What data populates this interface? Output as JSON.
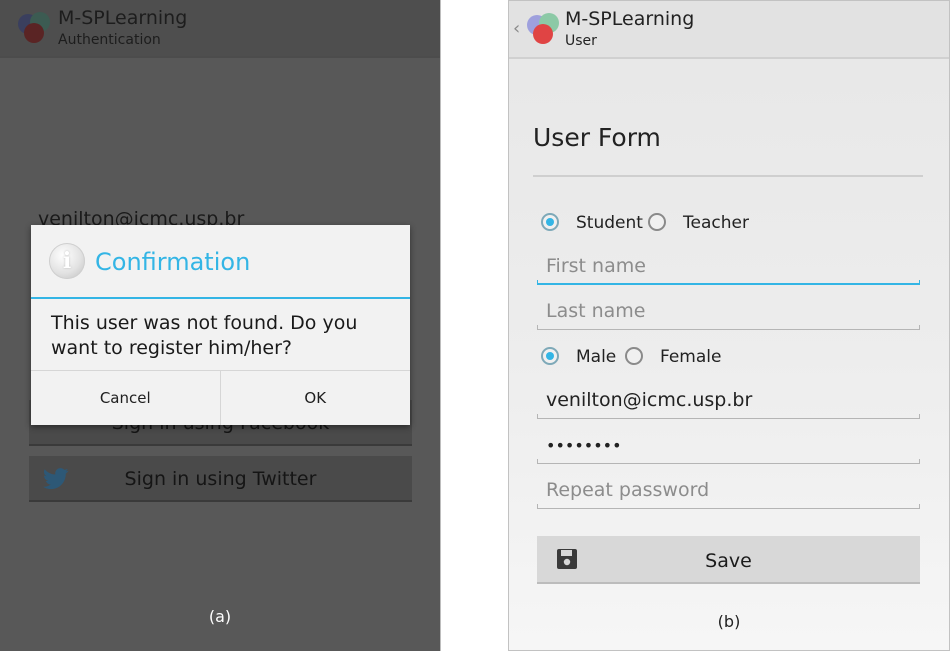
{
  "colors": {
    "accent": "#33b5e5",
    "dim_background": "#585858"
  },
  "panel_a": {
    "app_name": "M-SPLearning",
    "subtitle": "Authentication",
    "background_email": "venilton@icmc.usp.br",
    "facebook_button": "Sign in using Facebook",
    "twitter_button": "Sign in using Twitter",
    "dialog": {
      "title": "Confirmation",
      "icon": "info-icon",
      "message": "This user was not found. Do you want to register him/her?",
      "cancel_label": "Cancel",
      "ok_label": "OK"
    },
    "caption": "(a)"
  },
  "panel_b": {
    "app_name": "M-SPLearning",
    "subtitle": "User",
    "form_title": "User Form",
    "role_options": [
      {
        "label": "Student",
        "checked": true
      },
      {
        "label": "Teacher",
        "checked": false
      }
    ],
    "first_name": {
      "value": "",
      "placeholder": "First name"
    },
    "last_name": {
      "value": "",
      "placeholder": "Last name"
    },
    "gender_options": [
      {
        "label": "Male",
        "checked": true
      },
      {
        "label": "Female",
        "checked": false
      }
    ],
    "email": {
      "value": "venilton@icmc.usp.br"
    },
    "password": {
      "value": "••••••••"
    },
    "repeat_password": {
      "value": "",
      "placeholder": "Repeat password"
    },
    "save_label": "Save",
    "caption": "(b)"
  }
}
